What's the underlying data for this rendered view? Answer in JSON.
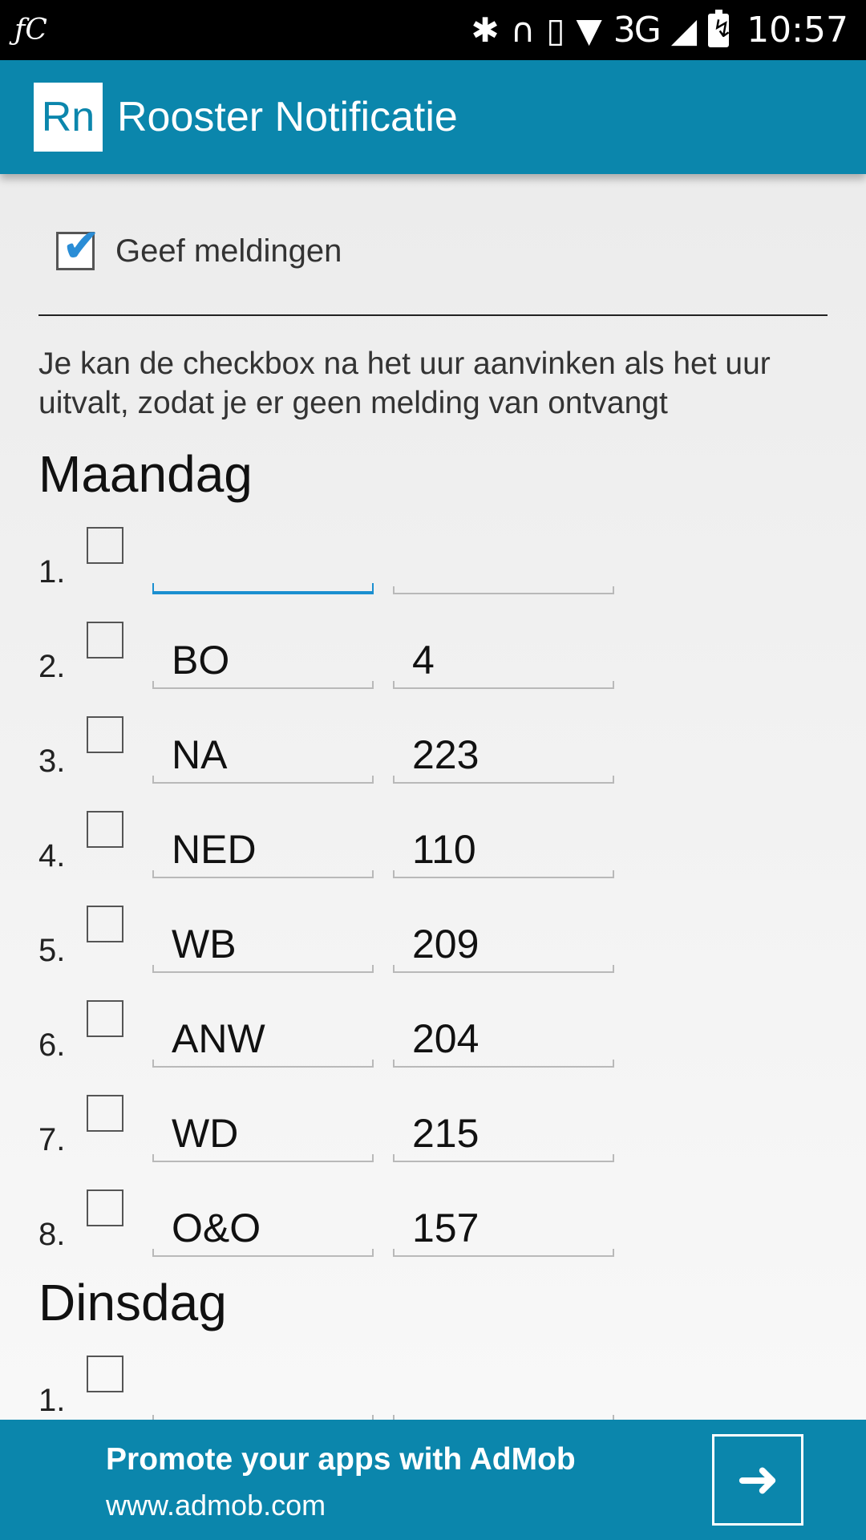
{
  "status_bar": {
    "left_icon": "nfc-icon",
    "left_text": "ƒC",
    "icons": [
      "bluetooth-icon",
      "headset-icon",
      "vibrate-icon",
      "wifi-icon",
      "signal-icon",
      "battery-charging-icon"
    ],
    "network": "3G",
    "time": "10:57"
  },
  "app_bar": {
    "logo": "Rn",
    "title": "Rooster Notificatie"
  },
  "settings": {
    "notify_label": "Geef meldingen",
    "notify_checked": true,
    "help_text": "Je kan de checkbox na het uur aanvinken als het uur uitvalt, zodat je er geen melding van ontvangt"
  },
  "days": [
    {
      "name": "Maandag",
      "rows": [
        {
          "num": "1.",
          "subject": "",
          "room": ""
        },
        {
          "num": "2.",
          "subject": "BO",
          "room": "4"
        },
        {
          "num": "3.",
          "subject": "NA",
          "room": "223"
        },
        {
          "num": "4.",
          "subject": "NED",
          "room": "110"
        },
        {
          "num": "5.",
          "subject": "WB",
          "room": "209"
        },
        {
          "num": "6.",
          "subject": "ANW",
          "room": "204"
        },
        {
          "num": "7.",
          "subject": "WD",
          "room": "215"
        },
        {
          "num": "8.",
          "subject": "O&O",
          "room": "157"
        }
      ]
    },
    {
      "name": "Dinsdag",
      "rows": [
        {
          "num": "1.",
          "subject": "",
          "room": ""
        }
      ]
    }
  ],
  "ad": {
    "title": "Promote your apps with AdMob",
    "url": "www.admob.com",
    "button_icon": "arrow-right-icon"
  },
  "colors": {
    "primary": "#0b86ac",
    "accent": "#1b8fd0",
    "status_bar": "#000000"
  }
}
